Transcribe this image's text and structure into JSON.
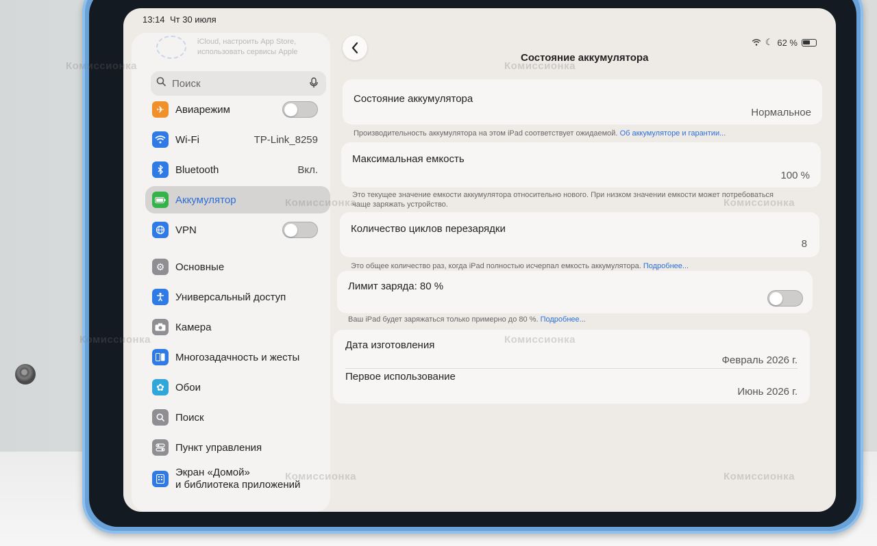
{
  "status_bar": {
    "time": "13:14",
    "date": "Чт 30 июля",
    "battery_percent": "62 %"
  },
  "sidebar": {
    "faded_text": "iCloud, настроить App Store, использовать сервисы Apple",
    "search_placeholder": "Поиск",
    "items": [
      {
        "label": "Авиарежим",
        "icon": "airplane-icon",
        "color": "#f0902a",
        "toggle": false
      },
      {
        "label": "Wi‑Fi",
        "icon": "wifi-icon",
        "color": "#2f7ae5",
        "value": "TP-Link_8259"
      },
      {
        "label": "Bluetooth",
        "icon": "bluetooth-icon",
        "color": "#2f7ae5",
        "value": "Вкл."
      },
      {
        "label": "Аккумулятор",
        "icon": "battery-icon",
        "color": "#35b24a",
        "selected": true
      },
      {
        "label": "VPN",
        "icon": "vpn-icon",
        "color": "#2f7ae5",
        "toggle": false
      },
      {
        "label": "Основные",
        "icon": "gear-icon",
        "color": "#8e8e93"
      },
      {
        "label": "Универсальный доступ",
        "icon": "accessibility-icon",
        "color": "#2f7ae5"
      },
      {
        "label": "Камера",
        "icon": "camera-icon",
        "color": "#8e8e93"
      },
      {
        "label": "Многозадачность и жесты",
        "icon": "multitasking-icon",
        "color": "#2f7ae5"
      },
      {
        "label": "Обои",
        "icon": "wallpaper-icon",
        "color": "#30a7d8"
      },
      {
        "label": "Поиск",
        "icon": "search-icon",
        "color": "#8e8e93"
      },
      {
        "label": "Пункт управления",
        "icon": "control-center-icon",
        "color": "#8e8e93"
      },
      {
        "label_line1": "Экран «Домой»",
        "label_line2": "и библиотека приложений",
        "icon": "home-screen-icon",
        "color": "#2f7ae5"
      }
    ]
  },
  "main": {
    "title": "Состояние аккумулятора",
    "battery_state": {
      "label": "Состояние аккумулятора",
      "value": "Нормальное",
      "desc": "Производительность аккумулятора на этом iPad соответствует ожидаемой.",
      "link": "Об аккумуляторе и гарантии..."
    },
    "max_capacity": {
      "label": "Максимальная емкость",
      "value": "100 %",
      "desc_line1": "Это текущее значение емкости аккумулятора относительно нового. При низком значении емкости может потребоваться",
      "desc_line2": "чаще заряжать устройство."
    },
    "cycle_count": {
      "label": "Количество циклов перезарядки",
      "value": "8",
      "desc": "Это общее количество раз, когда iPad полностью исчерпал емкость аккумулятора.",
      "link": "Подробнее..."
    },
    "charge_limit": {
      "label": "Лимит заряда: 80 %",
      "toggle": false,
      "desc": "Ваш iPad будет заряжаться только примерно до 80 %.",
      "link": "Подробнее..."
    },
    "manufacture": {
      "label": "Дата изготовления",
      "value": "Февраль 2026 г."
    },
    "first_use": {
      "label": "Первое использование",
      "value": "Июнь 2026 г."
    }
  },
  "watermark": "Комиссионка"
}
